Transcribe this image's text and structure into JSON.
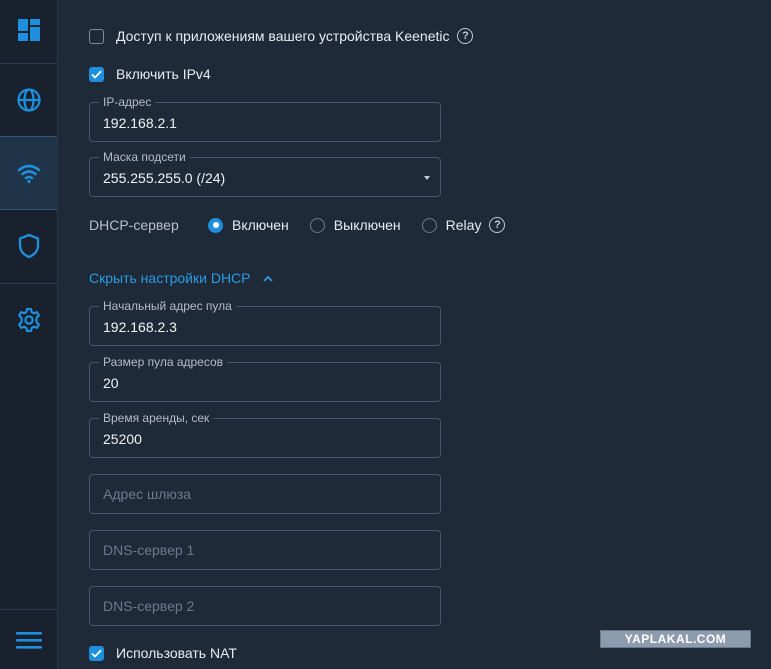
{
  "sidebar": {
    "items": [
      {
        "icon": "dashboard-icon"
      },
      {
        "icon": "globe-icon"
      },
      {
        "icon": "wifi-icon",
        "active": true
      },
      {
        "icon": "shield-icon"
      },
      {
        "icon": "gear-icon"
      },
      {
        "icon": "menu-icon"
      }
    ],
    "accent_color": "#1e8fdc"
  },
  "settings": {
    "app_access": {
      "label": "Доступ к приложениям вашего устройства Keenetic",
      "checked": false
    },
    "enable_ipv4": {
      "label": "Включить IPv4",
      "checked": true
    },
    "ip_address": {
      "label": "IP-адрес",
      "value": "192.168.2.1"
    },
    "subnet_mask": {
      "label": "Маска подсети",
      "value": "255.255.255.0 (/24)"
    },
    "dhcp": {
      "title": "DHCP-сервер",
      "options": [
        "Включен",
        "Выключен",
        "Relay"
      ],
      "selected": "Включен"
    },
    "dhcp_toggle_label": "Скрыть настройки DHCP",
    "pool_start": {
      "label": "Начальный адрес пула",
      "value": "192.168.2.3"
    },
    "pool_size": {
      "label": "Размер пула адресов",
      "value": "20"
    },
    "lease_time": {
      "label": "Время аренды, сек",
      "value": "25200"
    },
    "gateway": {
      "placeholder": "Адрес шлюза"
    },
    "dns1": {
      "placeholder": "DNS-сервер 1"
    },
    "dns2": {
      "placeholder": "DNS-сервер 2"
    },
    "use_nat": {
      "label": "Использовать NAT",
      "checked": true
    }
  },
  "watermark": "YAPLAKAL.COM"
}
